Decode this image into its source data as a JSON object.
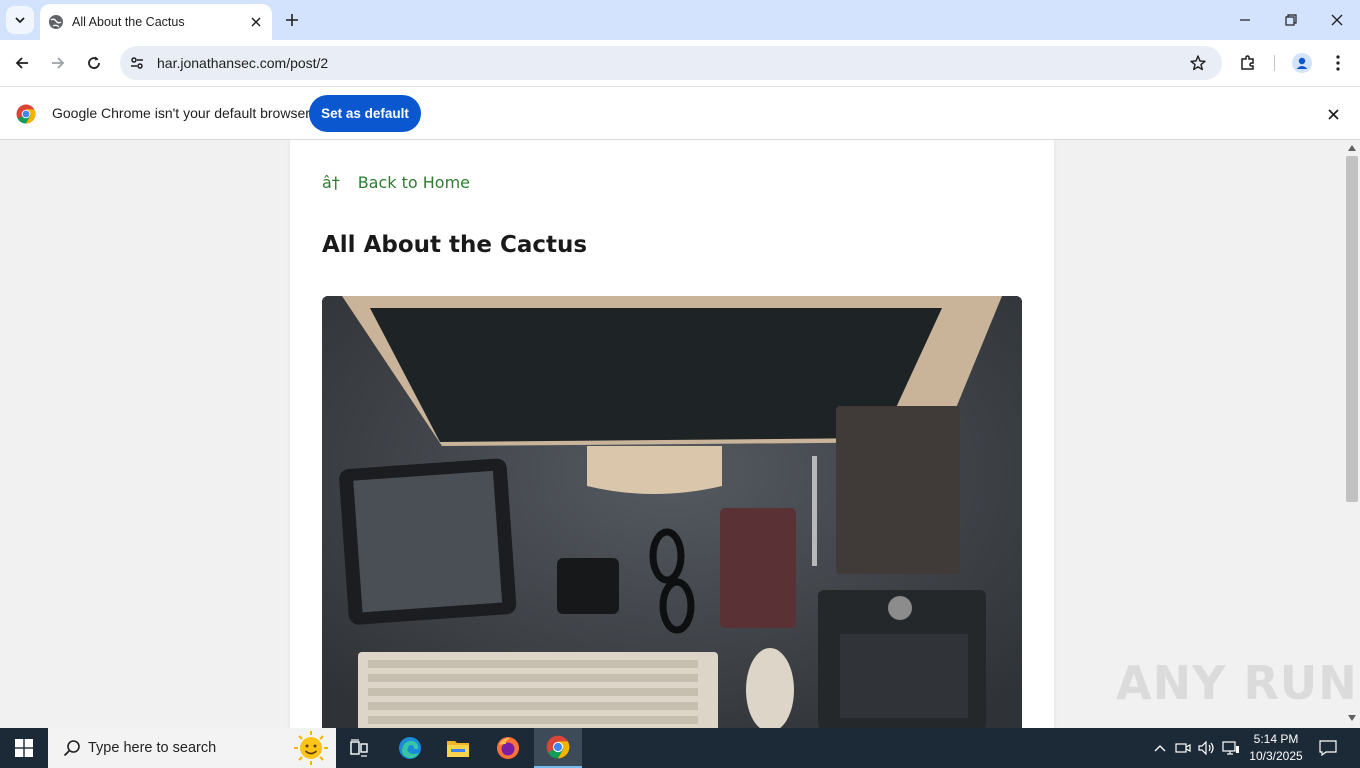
{
  "browser": {
    "tab": {
      "title": "All About the Cactus"
    },
    "url": "har.jonathansec.com/post/2"
  },
  "infobar": {
    "message": "Google Chrome isn't your default browser",
    "button_label": "Set as default"
  },
  "page": {
    "back_link": "â† Back to Home",
    "title": "All About the Cactus"
  },
  "watermark": "ANY RUN",
  "taskbar": {
    "search_placeholder": "Type here to search",
    "time": "5:14 PM",
    "date": "10/3/2025"
  },
  "colors": {
    "tabstrip": "#d3e3fd",
    "accent_button": "#0b57d0",
    "link": "#2e7d32",
    "taskbar": "#1c2a38"
  }
}
